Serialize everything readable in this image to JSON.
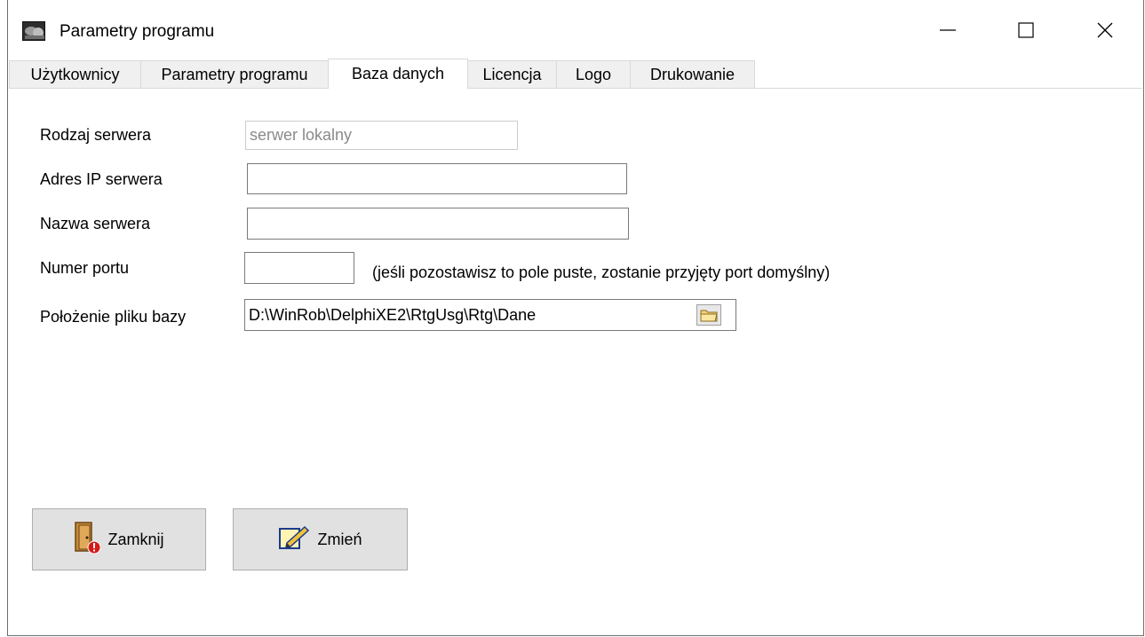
{
  "window": {
    "title": "Parametry programu",
    "icon": "app-photo-icon",
    "controls": [
      "minimize-icon",
      "maximize-icon",
      "close-icon"
    ]
  },
  "tabs": [
    {
      "label": "Użytkownicy",
      "active": false
    },
    {
      "label": "Parametry programu",
      "active": false
    },
    {
      "label": "Baza danych",
      "active": true
    },
    {
      "label": "Licencja",
      "active": false
    },
    {
      "label": "Logo",
      "active": false
    },
    {
      "label": "Drukowanie",
      "active": false
    }
  ],
  "form": {
    "server_type_label": "Rodzaj serwera",
    "server_type_value": "serwer lokalny",
    "server_ip_label": "Adres IP serwera",
    "server_ip_value": "",
    "server_name_label": "Nazwa serwera",
    "server_name_value": "",
    "port_label": "Numer portu",
    "port_value": "",
    "port_hint": "(jeśli pozostawisz to pole puste, zostanie przyjęty port domyślny)",
    "db_path_label": "Położenie pliku bazy",
    "db_path_value": "D:\\WinRob\\DelphiXE2\\RtgUsg\\Rtg\\Dane"
  },
  "buttons": {
    "close_label": "Zamknij",
    "close_icon": "door-exit-icon",
    "change_label": "Zmień",
    "change_icon": "edit-pencil-icon",
    "browse_icon": "folder-icon"
  },
  "colors": {
    "button_face": "#e1e1e1",
    "tab_inactive": "#f0f0f0",
    "disabled_text": "#8a8a8a"
  }
}
